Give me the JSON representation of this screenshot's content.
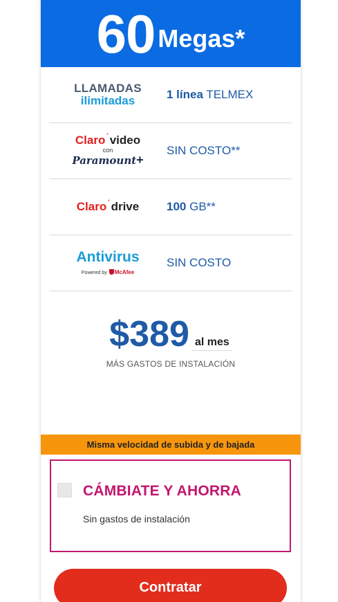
{
  "colors": {
    "header_bg": "#0a6be3",
    "banner_bg": "#f7960c",
    "promo_border": "#c2166e",
    "promo_title": "#c2166e",
    "cta_bg": "#e22d1d",
    "accent_blue": "#1f5aa6"
  },
  "header": {
    "speed_value": "60",
    "speed_unit": "Megas*"
  },
  "features": [
    {
      "logo": {
        "line1": "LLAMADAS",
        "line2": "ilimitadas"
      },
      "text_bold": "1 línea",
      "text": " TELMEX"
    },
    {
      "logo": {
        "brand": "Claro",
        "product": "video",
        "con": "con",
        "partner": "Paramount",
        "plus": "+"
      },
      "text_bold": "",
      "text": "SIN COSTO**"
    },
    {
      "logo": {
        "brand": "Claro",
        "product": "drive"
      },
      "text_bold": "100",
      "text": " GB**"
    },
    {
      "logo": {
        "name": "Antivirus",
        "powered": "Powered by",
        "partner": "McAfee"
      },
      "text_bold": "",
      "text": "SIN COSTO"
    }
  ],
  "price": {
    "amount": "$389",
    "period": "al mes",
    "note": "MÁS GASTOS DE INSTALACIÓN"
  },
  "banner": {
    "text": "Misma velocidad de subida y de bajada"
  },
  "promo": {
    "title": "CÁMBIATE Y AHORRA",
    "subtitle": "Sin gastos de instalación"
  },
  "cta": {
    "label": "Contratar"
  }
}
